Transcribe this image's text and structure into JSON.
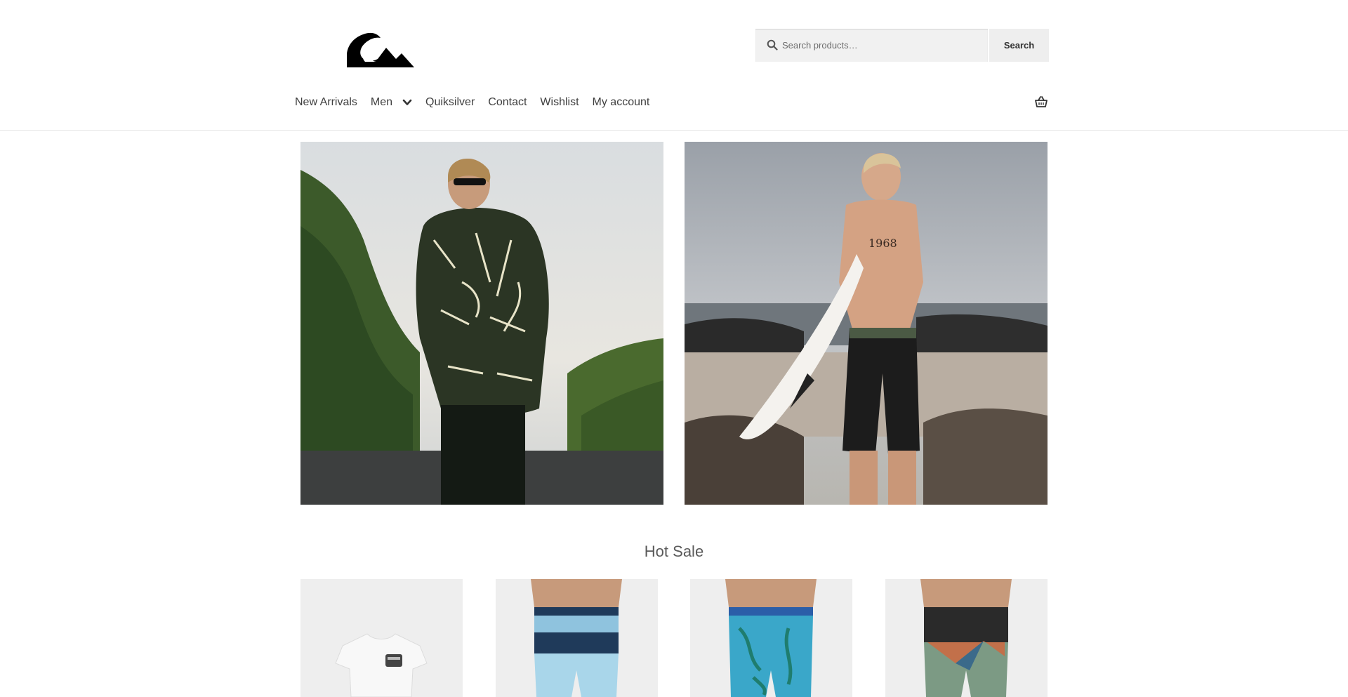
{
  "brand": {
    "logo_name": "Quiksilver mountain-wave logo"
  },
  "search": {
    "placeholder": "Search products…",
    "button_label": "Search"
  },
  "nav": {
    "items": [
      {
        "label": "New Arrivals"
      },
      {
        "label": "Men",
        "has_dropdown": true
      },
      {
        "label": "Quiksilver"
      },
      {
        "label": "Contact"
      },
      {
        "label": "Wishlist"
      },
      {
        "label": "My account"
      }
    ]
  },
  "cart": {
    "icon": "basket-icon"
  },
  "hero": [
    {
      "name": "hero-image-shirt"
    },
    {
      "name": "hero-image-surfboard"
    }
  ],
  "hot_sale": {
    "title": "Hot Sale",
    "products": [
      {
        "name": "white-tee"
      },
      {
        "name": "striped-boardshorts"
      },
      {
        "name": "tropical-boardshorts"
      },
      {
        "name": "colorblock-boardshorts"
      }
    ]
  },
  "colors": {
    "text": "#404040",
    "border": "#e6e6e6",
    "search_bg": "#f1f1f1",
    "button_bg": "#eeeeee"
  }
}
